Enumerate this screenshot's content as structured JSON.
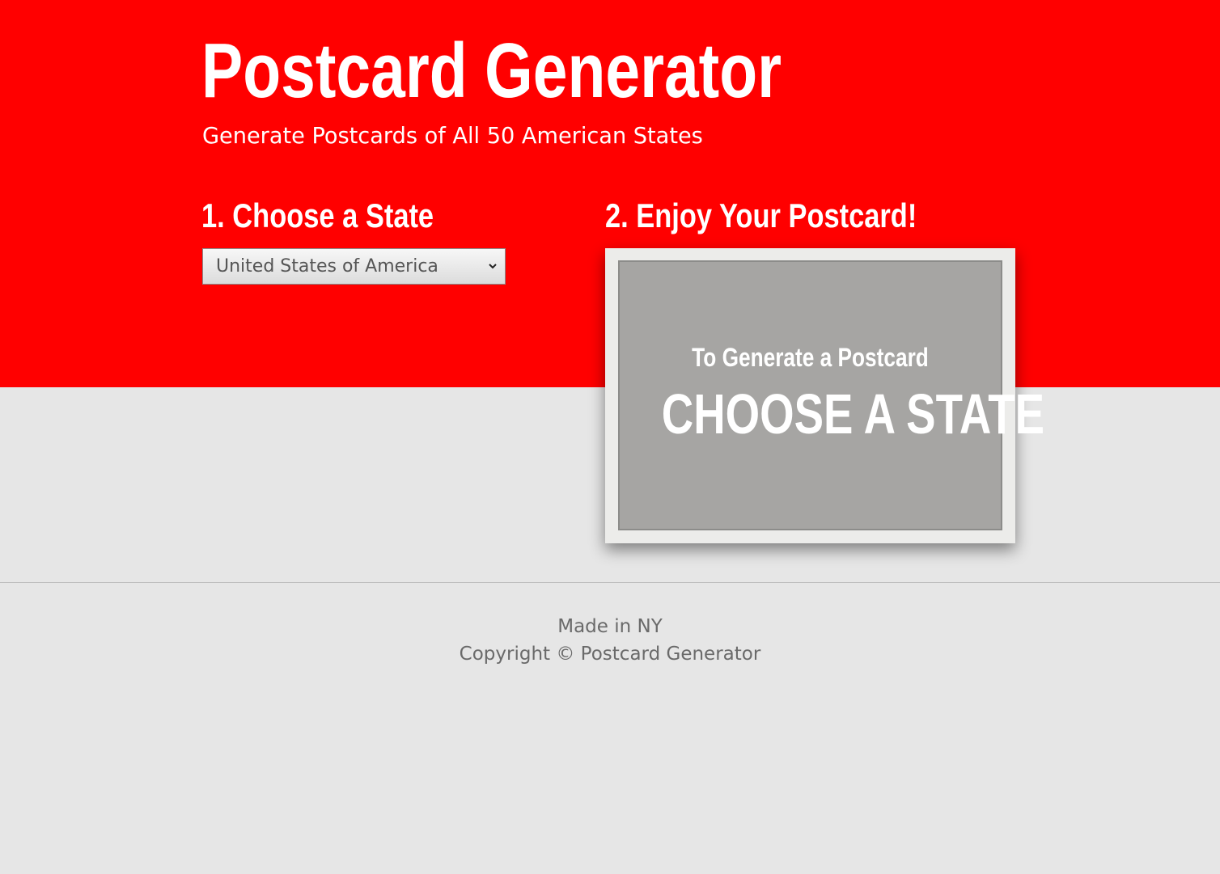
{
  "header": {
    "title": "Postcard Generator",
    "subtitle": "Generate Postcards of All 50 American States"
  },
  "steps": {
    "choose_heading": "1. Choose a State",
    "enjoy_heading": "2. Enjoy Your Postcard!"
  },
  "state_select": {
    "selected": "United States of America",
    "icon": "chevron-down-icon"
  },
  "postcard": {
    "line1": "To Generate a Postcard",
    "line2": "CHOOSE A STATE"
  },
  "footer": {
    "made_in": "Made in NY",
    "copyright": "Copyright © Postcard Generator"
  },
  "colors": {
    "hero_bg": "#ff0000",
    "page_bg": "#e6e6e6",
    "postcard_bg": "#a6a5a3"
  }
}
